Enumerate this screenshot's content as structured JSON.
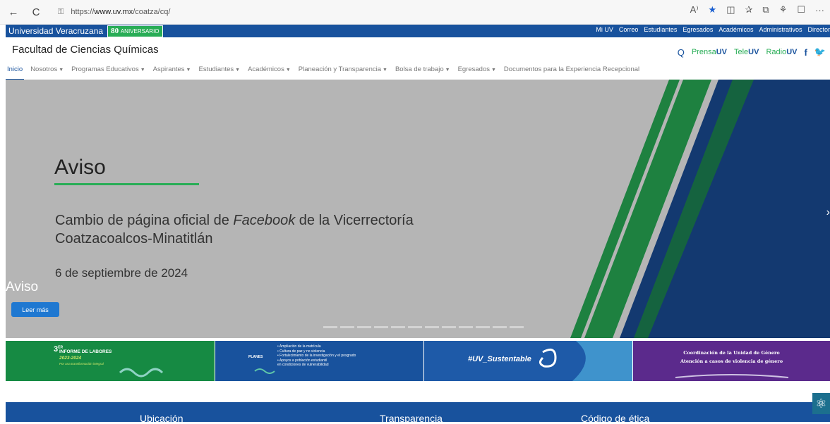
{
  "browser": {
    "url_prefix": "https://",
    "url_host": "www.uv.mx",
    "url_path": "/coatza/cq/",
    "back_icon": "←",
    "refresh_icon": "C",
    "lock_icon": "🔒",
    "icons": [
      "A⁾",
      "★",
      "◫",
      "✰",
      "⧉",
      "⚘",
      "☐",
      "···"
    ]
  },
  "uv_bar": {
    "name": "Universidad Veracruzana",
    "badge_num": "80",
    "badge_text": "ANIVERSARIO",
    "links": [
      "Mi UV",
      "Correo",
      "Estudiantes",
      "Egresados",
      "Académicos",
      "Administrativos",
      "Director"
    ]
  },
  "header": {
    "title": "Facultad de Ciencias Químicas",
    "right": {
      "search_icon": "Q",
      "prensa": "Prensa",
      "tele": "Tele",
      "radio": "Radio",
      "uv": "UV",
      "facebook_icon": "f",
      "twitter_icon": "🐦"
    }
  },
  "nav": {
    "items": [
      {
        "label": "Inicio",
        "caret": false
      },
      {
        "label": "Nosotros",
        "caret": true
      },
      {
        "label": "Programas Educativos",
        "caret": true
      },
      {
        "label": "Aspirantes",
        "caret": true
      },
      {
        "label": "Estudiantes",
        "caret": true
      },
      {
        "label": "Académicos",
        "caret": true
      },
      {
        "label": "Planeación y Transparencia",
        "caret": true
      },
      {
        "label": "Bolsa de trabajo",
        "caret": true
      },
      {
        "label": "Egresados",
        "caret": true
      },
      {
        "label": "Documentos para la Experiencia Recepcional",
        "caret": false
      }
    ]
  },
  "hero": {
    "title": "Aviso",
    "text_before": "Cambio de página oficial de ",
    "text_em": "Facebook",
    "text_after": " de la Vicerrectoría Coatzacoalcos-Minatitlán",
    "date": "6 de septiembre de 2024",
    "caption": "Aviso",
    "button": "Leer más",
    "slide_count": 12,
    "next_icon": "›"
  },
  "banners": {
    "b1": {
      "num": "3ER",
      "report": "INFORME DE LABORES",
      "years": "2023-2024",
      "tag": "Por una transformación integral"
    },
    "b2": {
      "planes": "PLANES",
      "items": [
        "• Ampliación de la matrícula",
        "• Cultura de paz y no violencia",
        "• Fortalecimiento de la investigación y el posgrado",
        "• Apoyos a población estudiantil",
        "  en condiciones de vulnerabilidad"
      ]
    },
    "b3": {
      "hash": "#UV_Sustentable"
    },
    "b4": {
      "line1": "Coordinación de la Unidad de Género",
      "line2": "Atención a casos de violencia de género"
    }
  },
  "footer": {
    "ubicacion": "Ubicación",
    "transparencia": "Transparencia",
    "codigo": "Código de ética"
  },
  "colors": {
    "uv_blue": "#18529d",
    "uv_green": "#28ad56"
  }
}
